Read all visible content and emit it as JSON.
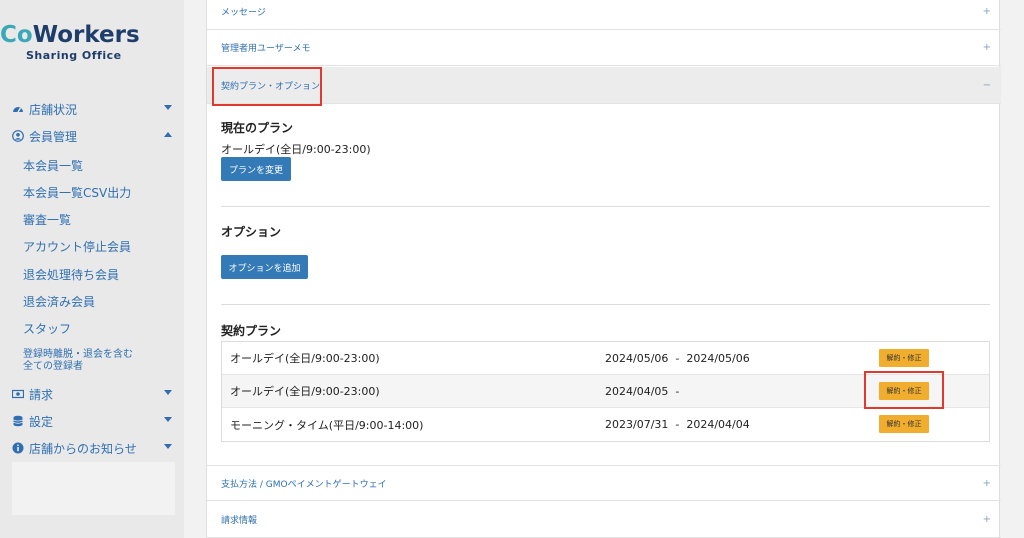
{
  "sidebar": {
    "logo_co": "Co",
    "logo_rest": "Workers",
    "logo_sub": "Sharing Office",
    "items": [
      {
        "label": "店舗状況",
        "icon": "dashboard-icon",
        "caret": "down"
      },
      {
        "label": "会員管理",
        "icon": "user-circle-icon",
        "caret": "up"
      },
      {
        "label": "請求",
        "icon": "money-icon",
        "caret": "down"
      },
      {
        "label": "設定",
        "icon": "database-icon",
        "caret": "down"
      },
      {
        "label": "店舗からのお知らせ",
        "icon": "info-icon",
        "caret": "down"
      }
    ],
    "subitems": [
      "本会員一覧",
      "本会員一覧CSV出力",
      "審査一覧",
      "アカウント停止会員",
      "退会処理待ち会員",
      "退会済み会員",
      "スタッフ",
      "登録時離脱・退会を含む\n全ての登録者"
    ]
  },
  "accordion": {
    "message": "メッセージ",
    "admin_memo": "管理者用ユーザーメモ",
    "contract": "契約プラン・オプション",
    "payment": "支払方法 / GMOペイメントゲートウェイ",
    "billing": "請求情報",
    "plus": "+",
    "minus": "−"
  },
  "current_plan": {
    "title": "現在のプラン",
    "value": "オールデイ(全日/9:00-23:00)",
    "button": "プランを変更"
  },
  "options": {
    "title": "オプション",
    "button": "オプションを追加"
  },
  "contracts": {
    "title": "契約プラン",
    "rows": [
      {
        "name": "オールデイ(全日/9:00-23:00)",
        "dates": "2024/05/06  -  2024/05/06",
        "action": "解約・修正"
      },
      {
        "name": "オールデイ(全日/9:00-23:00)",
        "dates": "2024/04/05  -",
        "action": "解約・修正"
      },
      {
        "name": "モーニング・タイム(平日/9:00-14:00)",
        "dates": "2023/07/31  -  2024/04/04",
        "action": "解約・修正"
      }
    ]
  },
  "colors": {
    "accent": "#337ab7",
    "warning": "#f0ad2e",
    "highlight": "#e03a2f",
    "link": "#2f6fb1"
  }
}
